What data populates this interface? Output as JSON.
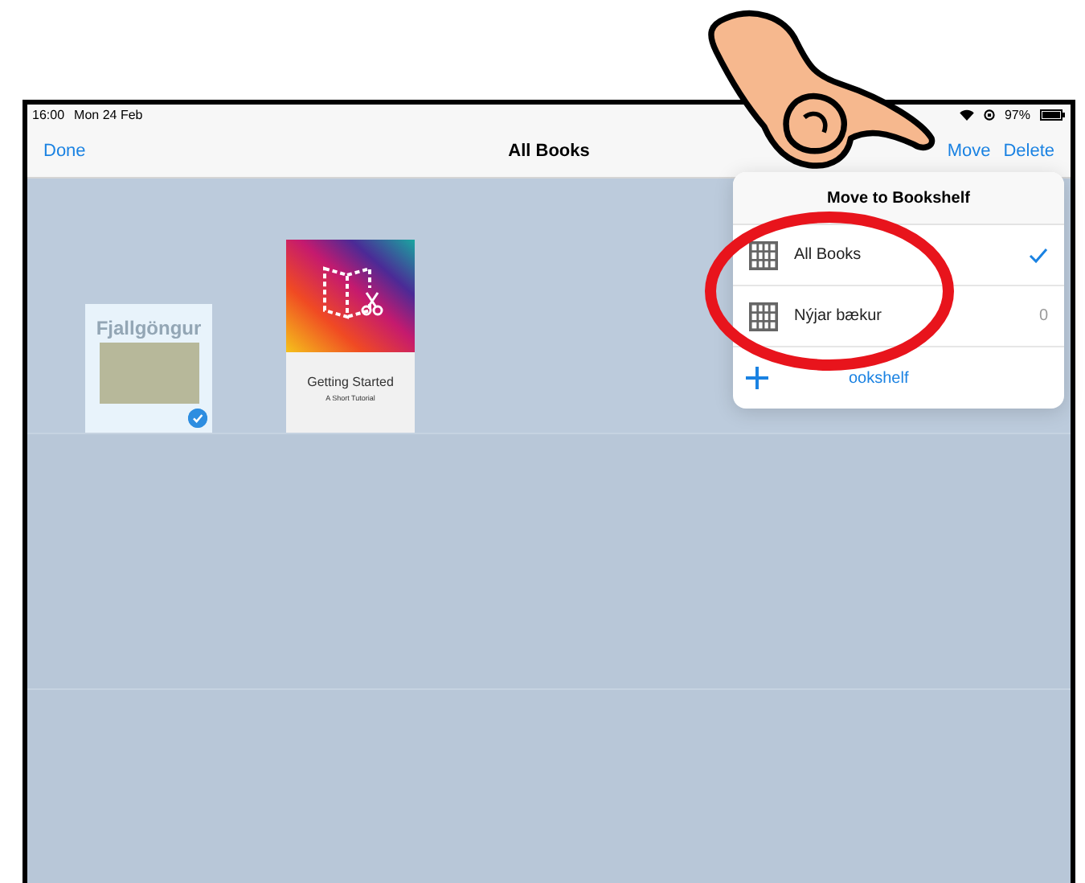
{
  "status_bar": {
    "time": "16:00",
    "date": "Mon 24 Feb",
    "battery": "97%"
  },
  "nav": {
    "left": "Done",
    "title": "All Books",
    "actions": [
      "Move",
      "Delete"
    ]
  },
  "books": [
    {
      "kind": "photo",
      "title": "Fjallgöngur",
      "selected": true
    },
    {
      "kind": "tutorial",
      "title": "Getting Started",
      "subtitle": "A Short Tutorial",
      "selected": false
    }
  ],
  "popover": {
    "title": "Move to Bookshelf",
    "shelves": [
      {
        "name": "All Books",
        "selected": true
      },
      {
        "name": "Nýjar bækur",
        "selected": false,
        "count": "0"
      }
    ],
    "new_shelf": "ookshelf"
  }
}
